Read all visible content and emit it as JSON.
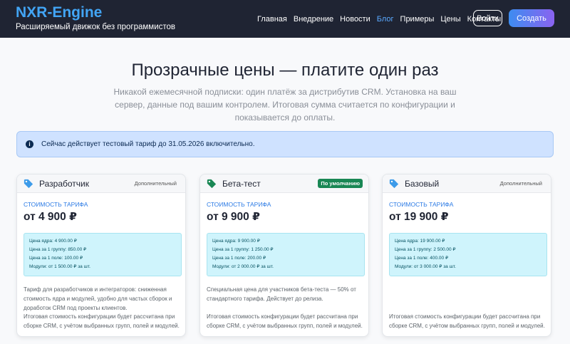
{
  "brand": {
    "title": "NXR-Engine",
    "subtitle": "Расширяемый движок без программистов"
  },
  "nav": {
    "items": [
      {
        "label": "Главная"
      },
      {
        "label": "Внедрение"
      },
      {
        "label": "Новости"
      },
      {
        "label": "Блог"
      },
      {
        "label": "Примеры"
      },
      {
        "label": "Цены"
      },
      {
        "label": "Контакты"
      }
    ],
    "login_label": "Войти",
    "create_label": "Создать"
  },
  "hero": {
    "title": "Прозрачные цены — платите один раз",
    "description": "Никакой ежемесячной подписки: один платёж за дистрибутив CRM. Установка на ваш сервер, данные под вашим контролем. Итоговая сумма считается по конфигурации и показывается до оплаты."
  },
  "alert": {
    "icon": "info-icon",
    "text": "Сейчас действует тестовый тариф до 31.05.2026 включительно."
  },
  "cards": [
    {
      "name": "Разработчик",
      "badge": "Дополнительный",
      "tag_color": "#3d9be9",
      "price_label": "СТОИМОСТЬ ТАРИФА",
      "price": "от 4 900 ₽",
      "lines": [
        "Цена ядра: 4 900.00 ₽",
        "Цена за 1 группу: 850.00 ₽",
        "Цена за 1 поле: 100.00 ₽",
        "Модули: от 1 500.00 ₽ за шт."
      ],
      "description": "Тариф для разработчиков и интеграторов: сниженная стоимость ядра и модулей, удобно для частых сборок и доработок CRM под проекты клиентов.",
      "footer": "Итоговая стоимость конфигурации будет рассчитана при сборке CRM, с учётом выбранных групп, полей и модулей."
    },
    {
      "name": "Бета-тест",
      "badge": "По умолчанию",
      "tag_color": "#198754",
      "price_label": "СТОИМОСТЬ ТАРИФА",
      "price": "от 9 900 ₽",
      "lines": [
        "Цена ядра: 9 900.00 ₽",
        "Цена за 1 группу: 1 250.00 ₽",
        "Цена за 1 поле: 200.00 ₽",
        "Модули: от 2 000.00 ₽ за шт."
      ],
      "description": "Специальная цена для участников бета-теста — 50% от стандартного тарифа. Действует до релиза.",
      "footer": "Итоговая стоимость конфигурации будет рассчитана при сборке CRM, с учётом выбранных групп, полей и модулей."
    },
    {
      "name": "Базовый",
      "badge": "Дополнительный",
      "tag_color": "#3d9be9",
      "price_label": "СТОИМОСТЬ ТАРИФА",
      "price": "от 19 900 ₽",
      "lines": [
        "Цена ядра: 19 900.00 ₽",
        "Цена за 1 группу: 2 500.00 ₽",
        "Цена за 1 поле: 400.00 ₽",
        "Модули: от 3 000.00 ₽ за шт."
      ],
      "description": "",
      "footer": "Итоговая стоимость конфигурации будет рассчитана при сборке CRM, с учётом выбранных групп, полей и модулей."
    }
  ]
}
